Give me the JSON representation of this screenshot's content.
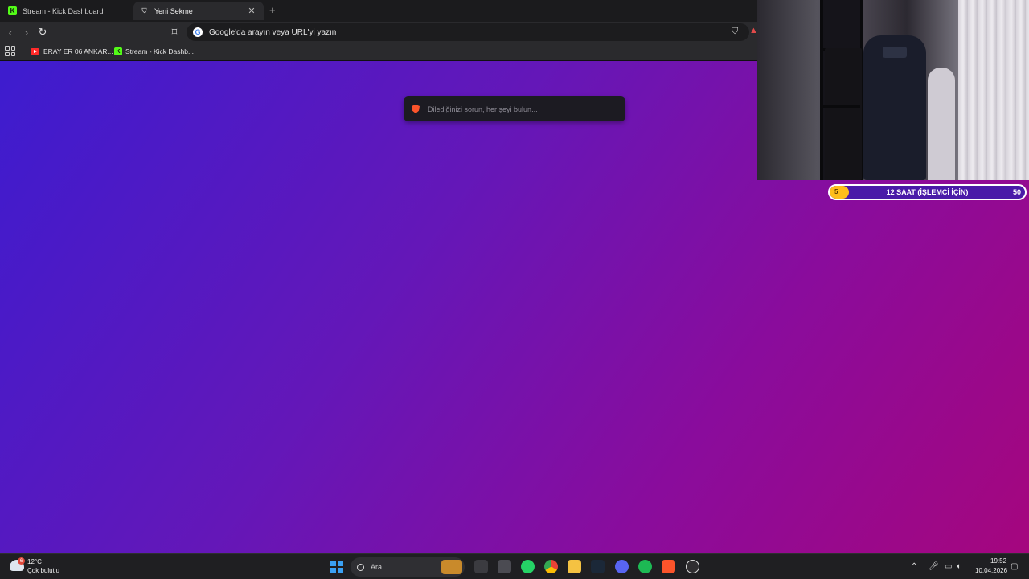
{
  "browser": {
    "tabs": [
      {
        "label": "Stream - Kick Dashboard",
        "icon": "kick-icon",
        "active": false
      },
      {
        "label": "Yeni Sekme",
        "icon": "brave-icon",
        "active": true
      }
    ],
    "close_glyph": "✕",
    "new_tab_glyph": "+",
    "omnibox_placeholder": "Google'da arayın veya URL'yi yazın",
    "bookmarks": [
      {
        "label": "ERAY ER 06 ANKAR...",
        "icon": "youtube-icon"
      },
      {
        "label": "Stream - Kick Dashb...",
        "icon": "kick-icon"
      }
    ]
  },
  "newtab": {
    "search_placeholder": "Dilediğinizi sorun, her şeyi bulun..."
  },
  "goal": {
    "current": "5",
    "title": "12 SAAT (İŞLEMCİ İÇİN)",
    "target": "50",
    "progress": 0.1,
    "fill_color": "#ffbe1a"
  },
  "taskbar": {
    "weather_temp": "12°C",
    "weather_desc": "Çok bulutlu",
    "weather_badge": "6",
    "search_label": "Ara",
    "time": "19:52",
    "date": "10.04.2026",
    "apps": [
      "file-explorer-icon",
      "store-icon",
      "whatsapp-icon",
      "chrome-icon",
      "folder-icon",
      "steam-icon",
      "discord-icon",
      "spotify-icon",
      "brave-icon",
      "obs-icon"
    ]
  },
  "colors": {
    "kick_green": "#53fc18",
    "brave_orange": "#fb542b",
    "page_gradient_start": "#3d1ccf",
    "page_gradient_end": "#a5067e"
  }
}
